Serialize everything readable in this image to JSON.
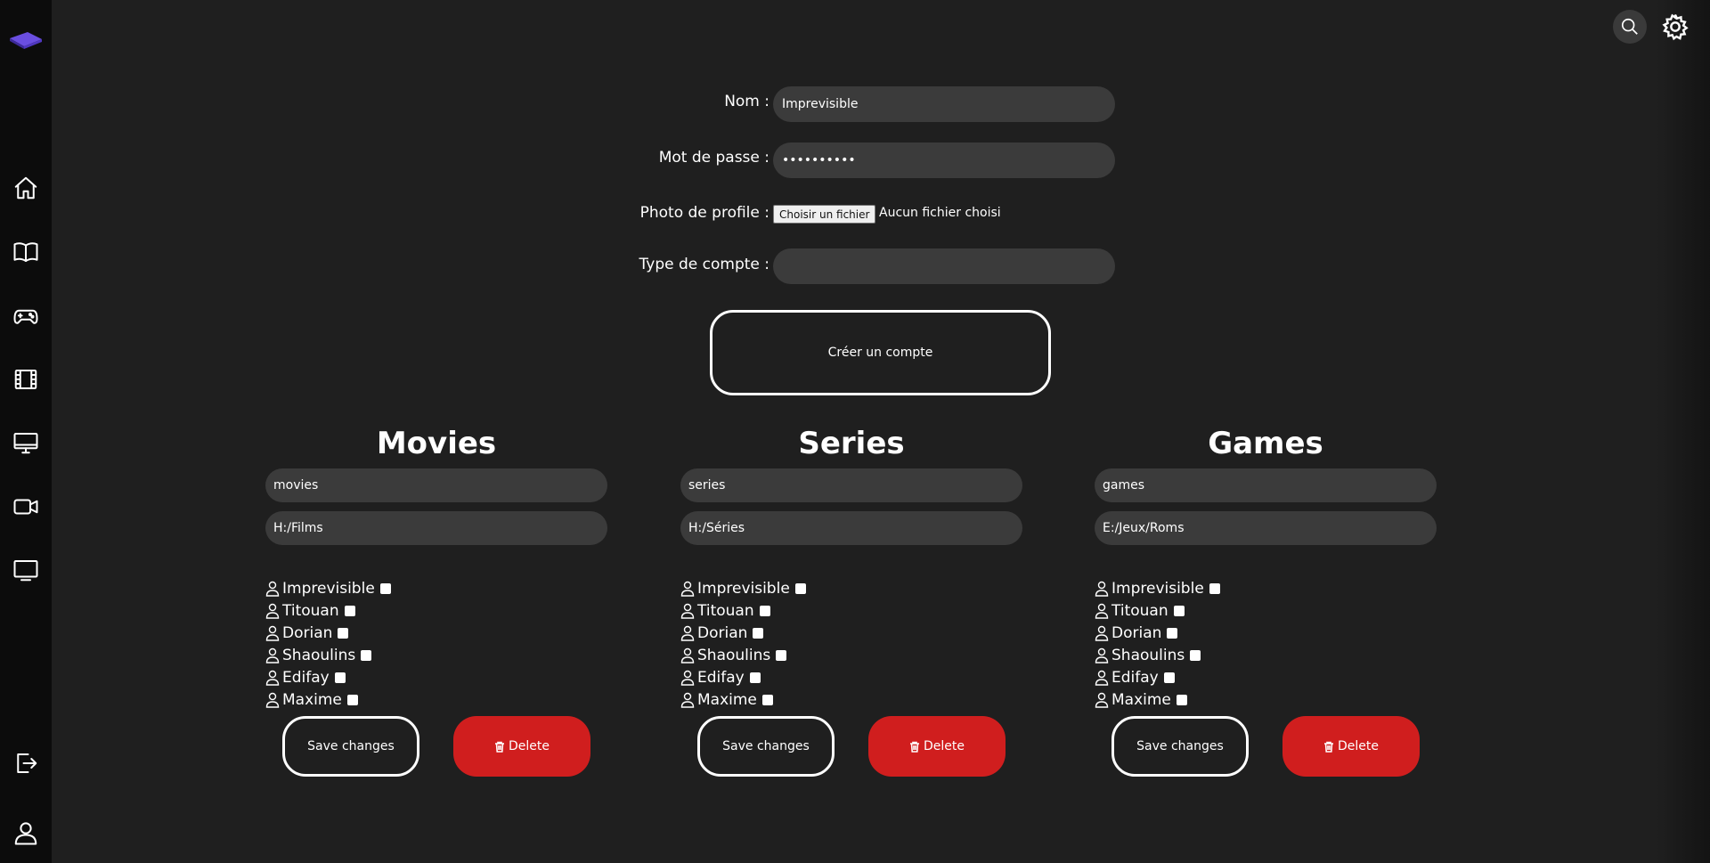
{
  "form": {
    "name_label": "Nom :",
    "name_value": "Imprevisible",
    "password_label": "Mot de passe :",
    "password_value": "••••••••••",
    "photo_label": "Photo de profile :",
    "file_button": "Choisir un fichier",
    "file_status": "Aucun fichier choisi",
    "account_type_label": "Type de compte :",
    "account_type_value": "",
    "create_button": "Créer un compte"
  },
  "sidebar": {
    "icons": [
      "logo-icon",
      "home-icon",
      "book-icon",
      "gamepad-icon",
      "film-icon",
      "monitor-icon",
      "video-camera-icon",
      "tv-icon",
      "logout-icon",
      "user-icon"
    ]
  },
  "topbar": {
    "icons": [
      "search-icon",
      "gear-icon"
    ]
  },
  "sections": [
    {
      "title": "Movies",
      "name_value": "movies",
      "path_value": "H:/Films",
      "users": [
        "Imprevisible",
        "Titouan",
        "Dorian",
        "Shaoulins",
        "Edifay",
        "Maxime"
      ],
      "save_label": "Save changes",
      "delete_label": "Delete"
    },
    {
      "title": "Series",
      "name_value": "series",
      "path_value": "H:/Séries",
      "users": [
        "Imprevisible",
        "Titouan",
        "Dorian",
        "Shaoulins",
        "Edifay",
        "Maxime"
      ],
      "save_label": "Save changes",
      "delete_label": "Delete"
    },
    {
      "title": "Games",
      "name_value": "games",
      "path_value": "E:/Jeux/Roms",
      "users": [
        "Imprevisible",
        "Titouan",
        "Dorian",
        "Shaoulins",
        "Edifay",
        "Maxime"
      ],
      "save_label": "Save changes",
      "delete_label": "Delete"
    }
  ],
  "colors": {
    "background": "#1f1f1f",
    "sidebar": "#0c0c0c",
    "input": "#3b3b3b",
    "delete": "#d01e1e",
    "logo": "#5b3fd6"
  }
}
